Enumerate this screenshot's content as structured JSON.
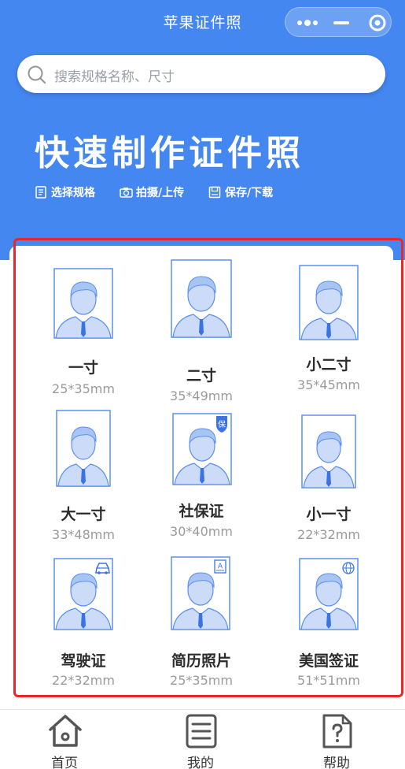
{
  "titlebar": {
    "title": "苹果证件照"
  },
  "search": {
    "placeholder": "搜索规格名称、尺寸"
  },
  "hero": {
    "title": "快速制作证件照",
    "steps": [
      {
        "label": "选择规格",
        "icon": "document-icon"
      },
      {
        "label": "拍摄/上传",
        "icon": "camera-icon"
      },
      {
        "label": "保存/下载",
        "icon": "save-icon"
      }
    ]
  },
  "specs": [
    {
      "name": "一寸",
      "size": "25*35mm",
      "badge": ""
    },
    {
      "name": "二寸",
      "size": "35*49mm",
      "badge": ""
    },
    {
      "name": "小二寸",
      "size": "35*45mm",
      "badge": ""
    },
    {
      "name": "大一寸",
      "size": "33*48mm",
      "badge": ""
    },
    {
      "name": "社保证",
      "size": "30*40mm",
      "badge": "保"
    },
    {
      "name": "小一寸",
      "size": "22*32mm",
      "badge": ""
    },
    {
      "name": "驾驶证",
      "size": "22*32mm",
      "badge": "car-icon"
    },
    {
      "name": "简历照片",
      "size": "25*35mm",
      "badge": "A"
    },
    {
      "name": "美国签证",
      "size": "51*51mm",
      "badge": "globe-icon"
    }
  ],
  "tabbar": {
    "items": [
      {
        "label": "首页",
        "icon": "home-icon"
      },
      {
        "label": "我的",
        "icon": "list-icon"
      },
      {
        "label": "帮助",
        "icon": "help-document-icon"
      }
    ]
  },
  "colors": {
    "brand": "#4487f1",
    "highlight": "#e8262b",
    "photo_line": "#5b8ff0"
  }
}
